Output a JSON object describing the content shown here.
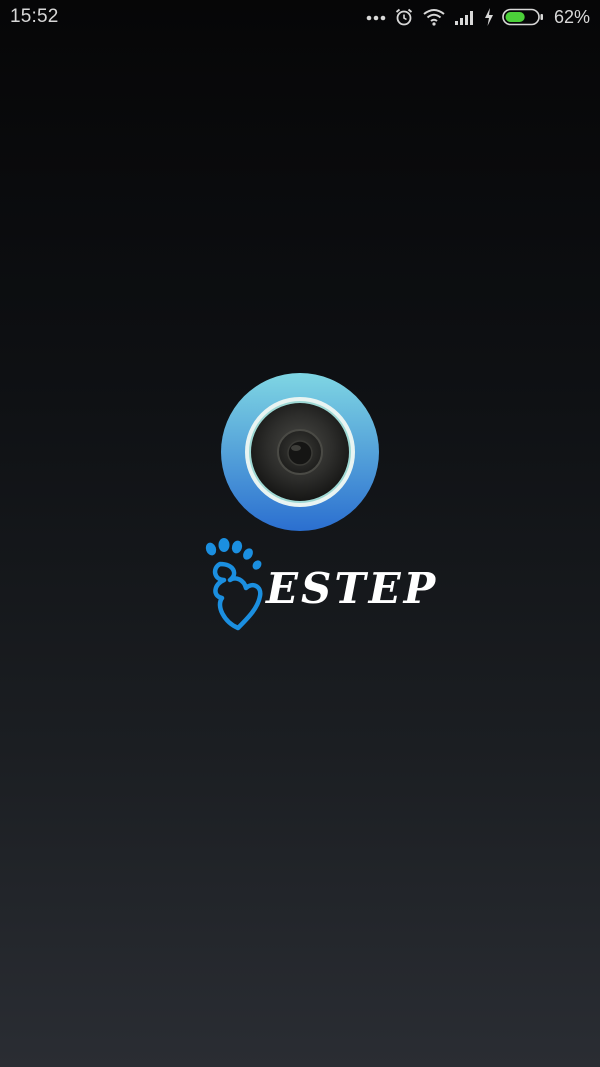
{
  "status_bar": {
    "time": "15:52",
    "battery_percent": "62%",
    "battery_level": 0.62,
    "icons": [
      "more-dots-icon",
      "alarm-icon",
      "wifi-icon",
      "signal-icon",
      "charging-bolt-icon",
      "battery-icon"
    ]
  },
  "splash": {
    "brand_name": "ESTEP",
    "colors": {
      "lens_ring_top": "#7fd6e3",
      "lens_ring_bottom": "#2b6fd0",
      "brand_mark": "#1b8fe0",
      "battery_fill": "#4cd13a"
    }
  }
}
